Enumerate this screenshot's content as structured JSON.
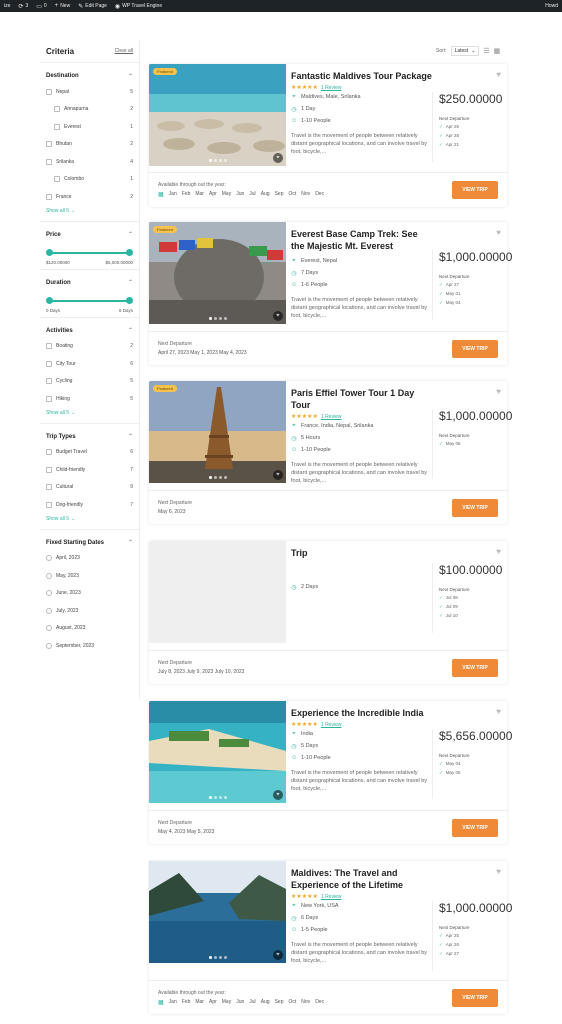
{
  "adminbar": {
    "left_edge": "ize",
    "updates": "3",
    "comments": "0",
    "new_label": "New",
    "edit_label": "Edit Page",
    "plugin_label": "WP Travel Engine",
    "howdy": "Howd"
  },
  "sidebar": {
    "title": "Criteria",
    "clear_all": "Clear all",
    "destination": {
      "title": "Destination",
      "items": [
        {
          "label": "Nepal",
          "count": "5"
        },
        {
          "label": "Annapurna",
          "count": "2"
        },
        {
          "label": "Everest",
          "count": "1"
        },
        {
          "label": "Bhutan",
          "count": "2"
        },
        {
          "label": "Srilanka",
          "count": "4"
        },
        {
          "label": "Colombo",
          "count": "1"
        },
        {
          "label": "France",
          "count": "2"
        }
      ],
      "show_all": "Show all 5"
    },
    "price": {
      "title": "Price",
      "min": "$120.00000",
      "max": "$5,000.00000"
    },
    "duration": {
      "title": "Duration",
      "min": "0 Days",
      "max": "6 Days"
    },
    "activities": {
      "title": "Activities",
      "items": [
        {
          "label": "Boating",
          "count": "2"
        },
        {
          "label": "City Tour",
          "count": "6"
        },
        {
          "label": "Cycling",
          "count": "5"
        },
        {
          "label": "Hiking",
          "count": "5"
        }
      ],
      "show_all": "Show all 5"
    },
    "trip_types": {
      "title": "Trip Types",
      "items": [
        {
          "label": "Budget Travel",
          "count": "6"
        },
        {
          "label": "Child-friendly",
          "count": "7"
        },
        {
          "label": "Cultural",
          "count": "9"
        },
        {
          "label": "Dog-friendly",
          "count": "7"
        }
      ],
      "show_all": "Show all 5"
    },
    "fixed_dates": {
      "title": "Fixed Starting Dates",
      "items": [
        "April, 2023",
        "May, 2023",
        "June, 2023",
        "July, 2023",
        "August, 2023",
        "September, 2023"
      ]
    }
  },
  "sort": {
    "label": "Sort:",
    "value": "Latest"
  },
  "trips": [
    {
      "featured": "Featured",
      "title": "Fantastic Maldives Tour Package",
      "review": "1 Review",
      "location": "Maldives, Male, Srilanka",
      "duration": "1 Day",
      "people": "1-10 People",
      "desc": "Travel is the movement of people between relatively distant geographical locations, and can involve travel by foot, bicycle,...",
      "price": "$250.00000",
      "next_label": "Next Departure",
      "next": [
        "Apr 26",
        "Apr 28",
        "Apr 21"
      ],
      "footer_label": "Available through out the year:",
      "months": [
        "Jan",
        "Feb",
        "Mar",
        "Apr",
        "May",
        "Jun",
        "Jul",
        "Aug",
        "Sep",
        "Oct",
        "Nov",
        "Dec"
      ],
      "button": "VIEW TRIP"
    },
    {
      "featured": "Featured",
      "title": "Everest Base Camp Trek: See the Majestic Mt. Everest",
      "location": "Everest, Nepal",
      "duration": "7 Days",
      "people": "1-6 People",
      "desc": "Travel is the movement of people between relatively distant geographical locations, and can involve travel by foot, bicycle,...",
      "price": "$1,000.00000",
      "next_label": "Next Departure",
      "next": [
        "Apr 27",
        "May 01",
        "May 04"
      ],
      "footer_label": "Next Departure",
      "footer_dates": "April 27, 2023   May 1, 2023   May 4, 2023",
      "button": "VIEW TRIP"
    },
    {
      "featured": "Featured",
      "title": "Paris Effiel Tower Tour 1 Day Tour",
      "review": "1 Review",
      "location": "France, India, Nepal, Srilanka",
      "duration": "5 Hours",
      "people": "1-10 People",
      "desc": "Travel is the movement of people between relatively distant geographical locations, and can involve travel by foot, bicycle,...",
      "price": "$1,000.00000",
      "next_label": "Next Departure",
      "next": [
        "May 06"
      ],
      "footer_label": "Next Departure",
      "footer_dates": "May 6, 2023",
      "button": "VIEW TRIP"
    },
    {
      "title": "Trip",
      "duration": "2 Days",
      "price": "$100.00000",
      "next_label": "Next Departure",
      "next": [
        "Jul 08",
        "Jul 09",
        "Jul 10"
      ],
      "footer_label": "Next Departure",
      "footer_dates": "July 8, 2023   July 9, 2023   July 10, 2023",
      "button": "VIEW TRIP"
    },
    {
      "title": "Experience the Incredible India",
      "review": "1 Review",
      "location": "India",
      "duration": "5 Days",
      "people": "1-10 People",
      "desc": "Travel is the movement of people between relatively distant geographical locations, and can involve travel by foot, bicycle,...",
      "price": "$5,656.00000",
      "next_label": "Next Departure",
      "next": [
        "May 04",
        "May 05"
      ],
      "footer_label": "Next Departure",
      "footer_dates": "May 4, 2023   May 5, 2023",
      "button": "VIEW TRIP"
    },
    {
      "title": "Maldives: The Travel and Experience of the Lifetime",
      "review": "1 Review",
      "location": "New York, USA",
      "duration": "6 Days",
      "people": "1-5 People",
      "desc": "Travel is the movement of people between relatively distant geographical locations, and can involve travel by foot, bicycle,...",
      "price": "$1,000.00000",
      "next_label": "Next Departure",
      "next": [
        "Apr 25",
        "Apr 26",
        "Apr 27"
      ],
      "footer_label": "Available through out the year:",
      "months": [
        "Jan",
        "Feb",
        "Mar",
        "Apr",
        "May",
        "Jun",
        "Jul",
        "Aug",
        "Sep",
        "Oct",
        "Nov",
        "Dec"
      ],
      "button": "VIEW TRIP"
    }
  ],
  "colors": {
    "accent": "#2bb5a3",
    "button": "#ef8a38",
    "star": "#f5a623",
    "featured": "#f5c24d"
  }
}
